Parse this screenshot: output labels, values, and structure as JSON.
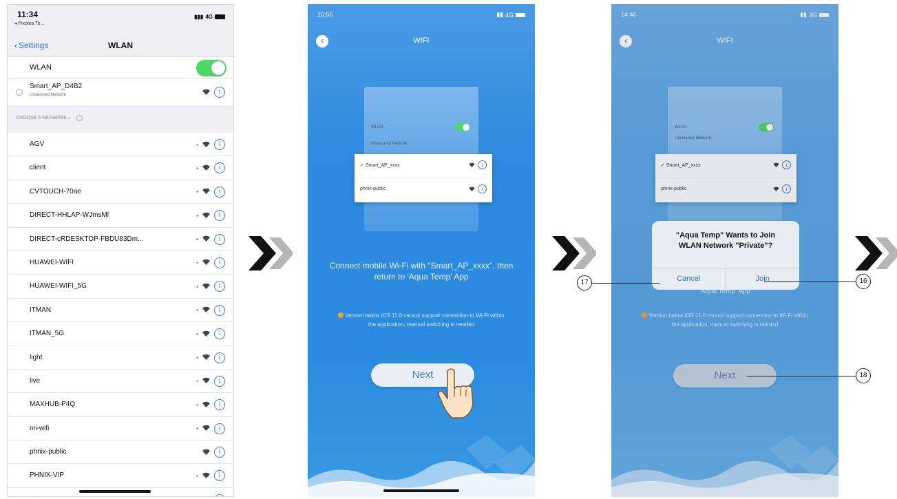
{
  "screen1": {
    "status": {
      "time": "11:34",
      "back_app": "◂ Pixolea Te...",
      "signal": "4G"
    },
    "nav": {
      "back_label": "Settings",
      "title": "WLAN"
    },
    "wlan_label": "WLAN",
    "wlan_on": true,
    "current_network": {
      "name": "Smart_AP_D4B2",
      "subtitle": "Unsecured Network"
    },
    "section_header": "CHOOSE A NETWORK...",
    "networks": [
      {
        "name": "AGV"
      },
      {
        "name": "client"
      },
      {
        "name": "CVTOUCH-70ae"
      },
      {
        "name": "DIRECT-HHLAP-WJmsMl"
      },
      {
        "name": "DIRECT-cRDESKTOP-FBDU83Dm..."
      },
      {
        "name": "HUAWEI-WIFI"
      },
      {
        "name": "HUAWEI-WIFI_5G"
      },
      {
        "name": "ITMAN"
      },
      {
        "name": "ITMAN_5G"
      },
      {
        "name": "light"
      },
      {
        "name": "live"
      },
      {
        "name": "MAXHUB-P4Q"
      },
      {
        "name": "mi-wifi"
      },
      {
        "name": "phnix-public"
      },
      {
        "name": "PHNIX-VIP"
      },
      {
        "name": "Private"
      }
    ]
  },
  "screen2": {
    "status": {
      "time": "15:56",
      "signal": "4G"
    },
    "title": "WIFI",
    "illustration": {
      "row1": "Smart_AP_xxxx",
      "row2": "phnix-public",
      "mini_label1": "WLAN",
      "mini_label2": "Unsecured Network"
    },
    "connect_text": "Connect mobile Wi-Fi with \"Smart_AP_xxxx\", then return to 'Aqua Temp' App",
    "note_text": "Version below iOS 11.0 cannot support connection to Wi-Fi within the application, manual switching is needed",
    "next_label": "Next"
  },
  "screen3": {
    "status": {
      "time": "14:46",
      "signal": "4G"
    },
    "title": "WIFI",
    "illustration": {
      "row1": "Smart_AP_xxxx",
      "row2": "phnix-public",
      "mini_label1": "WLAN",
      "mini_label2": "Unsecured Network"
    },
    "dialog": {
      "message_line1": "\"Aqua Temp\" Wants to Join",
      "message_line2": "WLAN Network \"Private\"?",
      "cancel_label": "Cancel",
      "join_label": "Join"
    },
    "behind_text": "'Aqua Temp' App",
    "note_text": "Version below iOS 11.0 cannot support connection to Wi-Fi within the application, manual switching is needed",
    "next_label": "Next"
  },
  "callouts": {
    "cancel": "17",
    "join": "16",
    "next": "18"
  },
  "colors": {
    "ios_blue": "#2a72c8",
    "toggle_green": "#4cd964",
    "app_blue": "#2a8bdf",
    "note_orange": "#f4a428",
    "chevron_dark": "#111111",
    "chevron_light": "#b5b5b5"
  }
}
